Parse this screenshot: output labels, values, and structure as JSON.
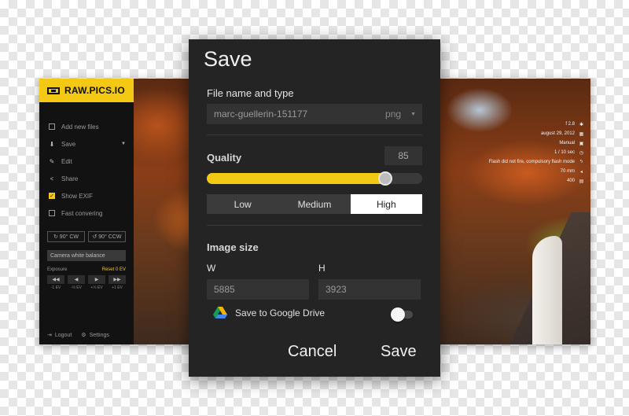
{
  "app": {
    "brand": "RAW.PICS.IO",
    "menu": [
      {
        "icon": "image-icon",
        "label": "Add new files"
      },
      {
        "icon": "download-icon",
        "label": "Save"
      },
      {
        "icon": "pencil-icon",
        "label": "Edit"
      },
      {
        "icon": "share-icon",
        "label": "Share"
      },
      {
        "icon": "checkbox-checked-icon",
        "label": "Show EXIF"
      },
      {
        "icon": "checkbox-icon",
        "label": "Fast convering"
      }
    ],
    "rotate_cw": "90° CW",
    "rotate_ccw": "90° CCW",
    "white_balance": "Camera white balance",
    "exposure_label": "Exposure",
    "exposure_reset": "Reset 0 EV",
    "exposure_buttons": [
      "◀◀",
      "◀",
      "▶",
      "▶▶"
    ],
    "exposure_values": [
      "-1 EV",
      "-½ EV",
      "+½ EV",
      "+1 EV"
    ],
    "logout": "Logout",
    "settings": "Settings",
    "exif": [
      {
        "value": "f 2.8",
        "icon": "aperture-icon"
      },
      {
        "value": "august 29, 2012",
        "icon": "calendar-icon"
      },
      {
        "value": "Manual",
        "icon": "camera-mode-icon"
      },
      {
        "value": "1 / 10 sec",
        "icon": "shutter-icon"
      },
      {
        "value": "Flash did not fire, compulsory flash mode",
        "icon": "flash-icon"
      },
      {
        "value": "70 mm",
        "icon": "focal-length-icon"
      },
      {
        "value": "400",
        "icon": "iso-icon"
      }
    ]
  },
  "dialog": {
    "title": "Save",
    "file_section_label": "File name and type",
    "file_name": "marc-guellerin-151177",
    "file_type": "png",
    "quality_label": "Quality",
    "quality_value": "85",
    "quality_fraction": 0.83,
    "presets": [
      "Low",
      "Medium",
      "High"
    ],
    "preset_selected": "High",
    "image_size_label": "Image size",
    "width_label": "W",
    "height_label": "H",
    "width": "5885",
    "height": "3923",
    "gdrive_label": "Save to Google Drive",
    "cancel": "Cancel",
    "save": "Save"
  }
}
